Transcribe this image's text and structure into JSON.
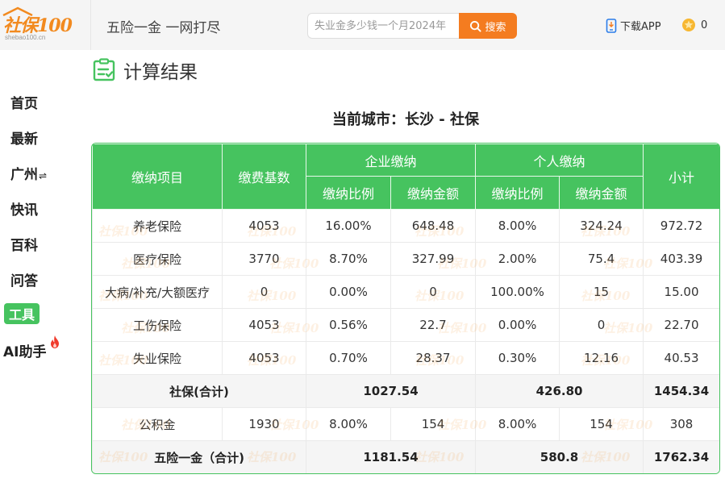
{
  "header": {
    "logo_text": "社保100",
    "logo_sub": "shebao100.cn",
    "slogan": "五险一金 一网打尽",
    "search_placeholder": "失业金多少钱一个月2024年",
    "search_button": "搜索",
    "download_label": "下载APP",
    "coin_count": "0"
  },
  "sidebar": {
    "items": [
      {
        "label": "首页"
      },
      {
        "label": "最新"
      },
      {
        "label": "广州",
        "suffix": "⇌"
      },
      {
        "label": "快讯"
      },
      {
        "label": "百科"
      },
      {
        "label": "问答"
      },
      {
        "label": "工具",
        "active": true
      },
      {
        "label": "AI助手"
      }
    ]
  },
  "main": {
    "title": "计算结果",
    "city_line": "当前城市：长沙 - 社保",
    "table": {
      "headers": {
        "item": "缴纳项目",
        "base": "缴费基数",
        "company": "企业缴纳",
        "personal": "个人缴纳",
        "subtotal": "小计",
        "ratio": "缴纳比例",
        "amount": "缴纳金额"
      },
      "rows": [
        [
          "养老保险",
          "4053",
          "16.00%",
          "648.48",
          "8.00%",
          "324.24",
          "972.72"
        ],
        [
          "医疗保险",
          "3770",
          "8.70%",
          "327.99",
          "2.00%",
          "75.4",
          "403.39"
        ],
        [
          "大病/补充/大额医疗",
          "0",
          "0.00%",
          "0",
          "100.00%",
          "15",
          "15.00"
        ],
        [
          "工伤保险",
          "4053",
          "0.56%",
          "22.7",
          "0.00%",
          "0",
          "22.70"
        ],
        [
          "失业保险",
          "4053",
          "0.70%",
          "28.37",
          "0.30%",
          "12.16",
          "40.53"
        ]
      ],
      "social_total": {
        "label": "社保(合计)",
        "company": "1027.54",
        "personal": "426.80",
        "subtotal": "1454.34"
      },
      "fund_row": [
        "公积金",
        "1930",
        "8.00%",
        "154",
        "8.00%",
        "154",
        "308"
      ],
      "grand_total": {
        "label": "五险一金（合计)",
        "company": "1181.54",
        "personal": "580.8",
        "subtotal": "1762.34"
      }
    }
  },
  "colors": {
    "accent_green": "#46c35f",
    "accent_orange": "#f47c20"
  }
}
